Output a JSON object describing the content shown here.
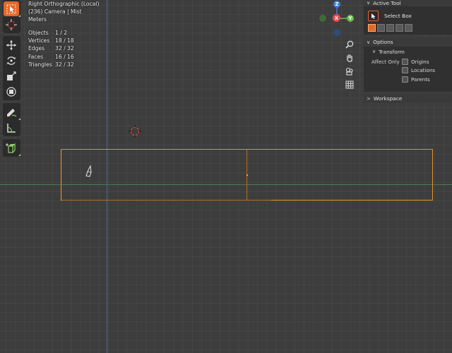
{
  "viewport": {
    "view_name": "Right Orthographic (Local)",
    "collection_line": "(236) Camera | Mist",
    "units": "Meters",
    "stats": [
      {
        "label": "Objects",
        "value": "1 / 2"
      },
      {
        "label": "Vertices",
        "value": "18 / 18"
      },
      {
        "label": "Edges",
        "value": "32 / 32"
      },
      {
        "label": "Faces",
        "value": "16 / 16"
      },
      {
        "label": "Triangles",
        "value": "32 / 32"
      }
    ]
  },
  "gizmo": {
    "z_label": "Z",
    "x_label": "X",
    "y_label": "Y",
    "colors": {
      "x": "#e8494f",
      "y": "#6dbd4a",
      "z": "#3b80d8",
      "neg_x": "#7a3a3e",
      "neg_y": "#3f6a39",
      "neg_z": "#2f4d7a"
    }
  },
  "toolbar": {
    "tools": [
      "select-box-tool",
      "cursor-tool",
      "move-tool",
      "rotate-tool",
      "scale-tool",
      "transform-tool",
      "annotate-tool",
      "measure-tool",
      "add-cube-tool"
    ],
    "active": "select-box-tool",
    "accent": "#e3692a"
  },
  "sidebar": {
    "active_tool": {
      "header": "Active Tool",
      "tool_name": "Select Box"
    },
    "options": {
      "header": "Options",
      "transform_header": "Transform",
      "affect_only_label": "Affect Only",
      "checkboxes": [
        {
          "label": "Origins",
          "checked": false
        },
        {
          "label": "Locations",
          "checked": false
        },
        {
          "label": "Parents",
          "checked": false
        }
      ]
    },
    "workspace": {
      "header": "Workspace"
    }
  },
  "colors": {
    "selection_outline": "#e3912a",
    "z_axis_line": "#4f6a8a",
    "y_axis_line": "#4a7a53"
  }
}
